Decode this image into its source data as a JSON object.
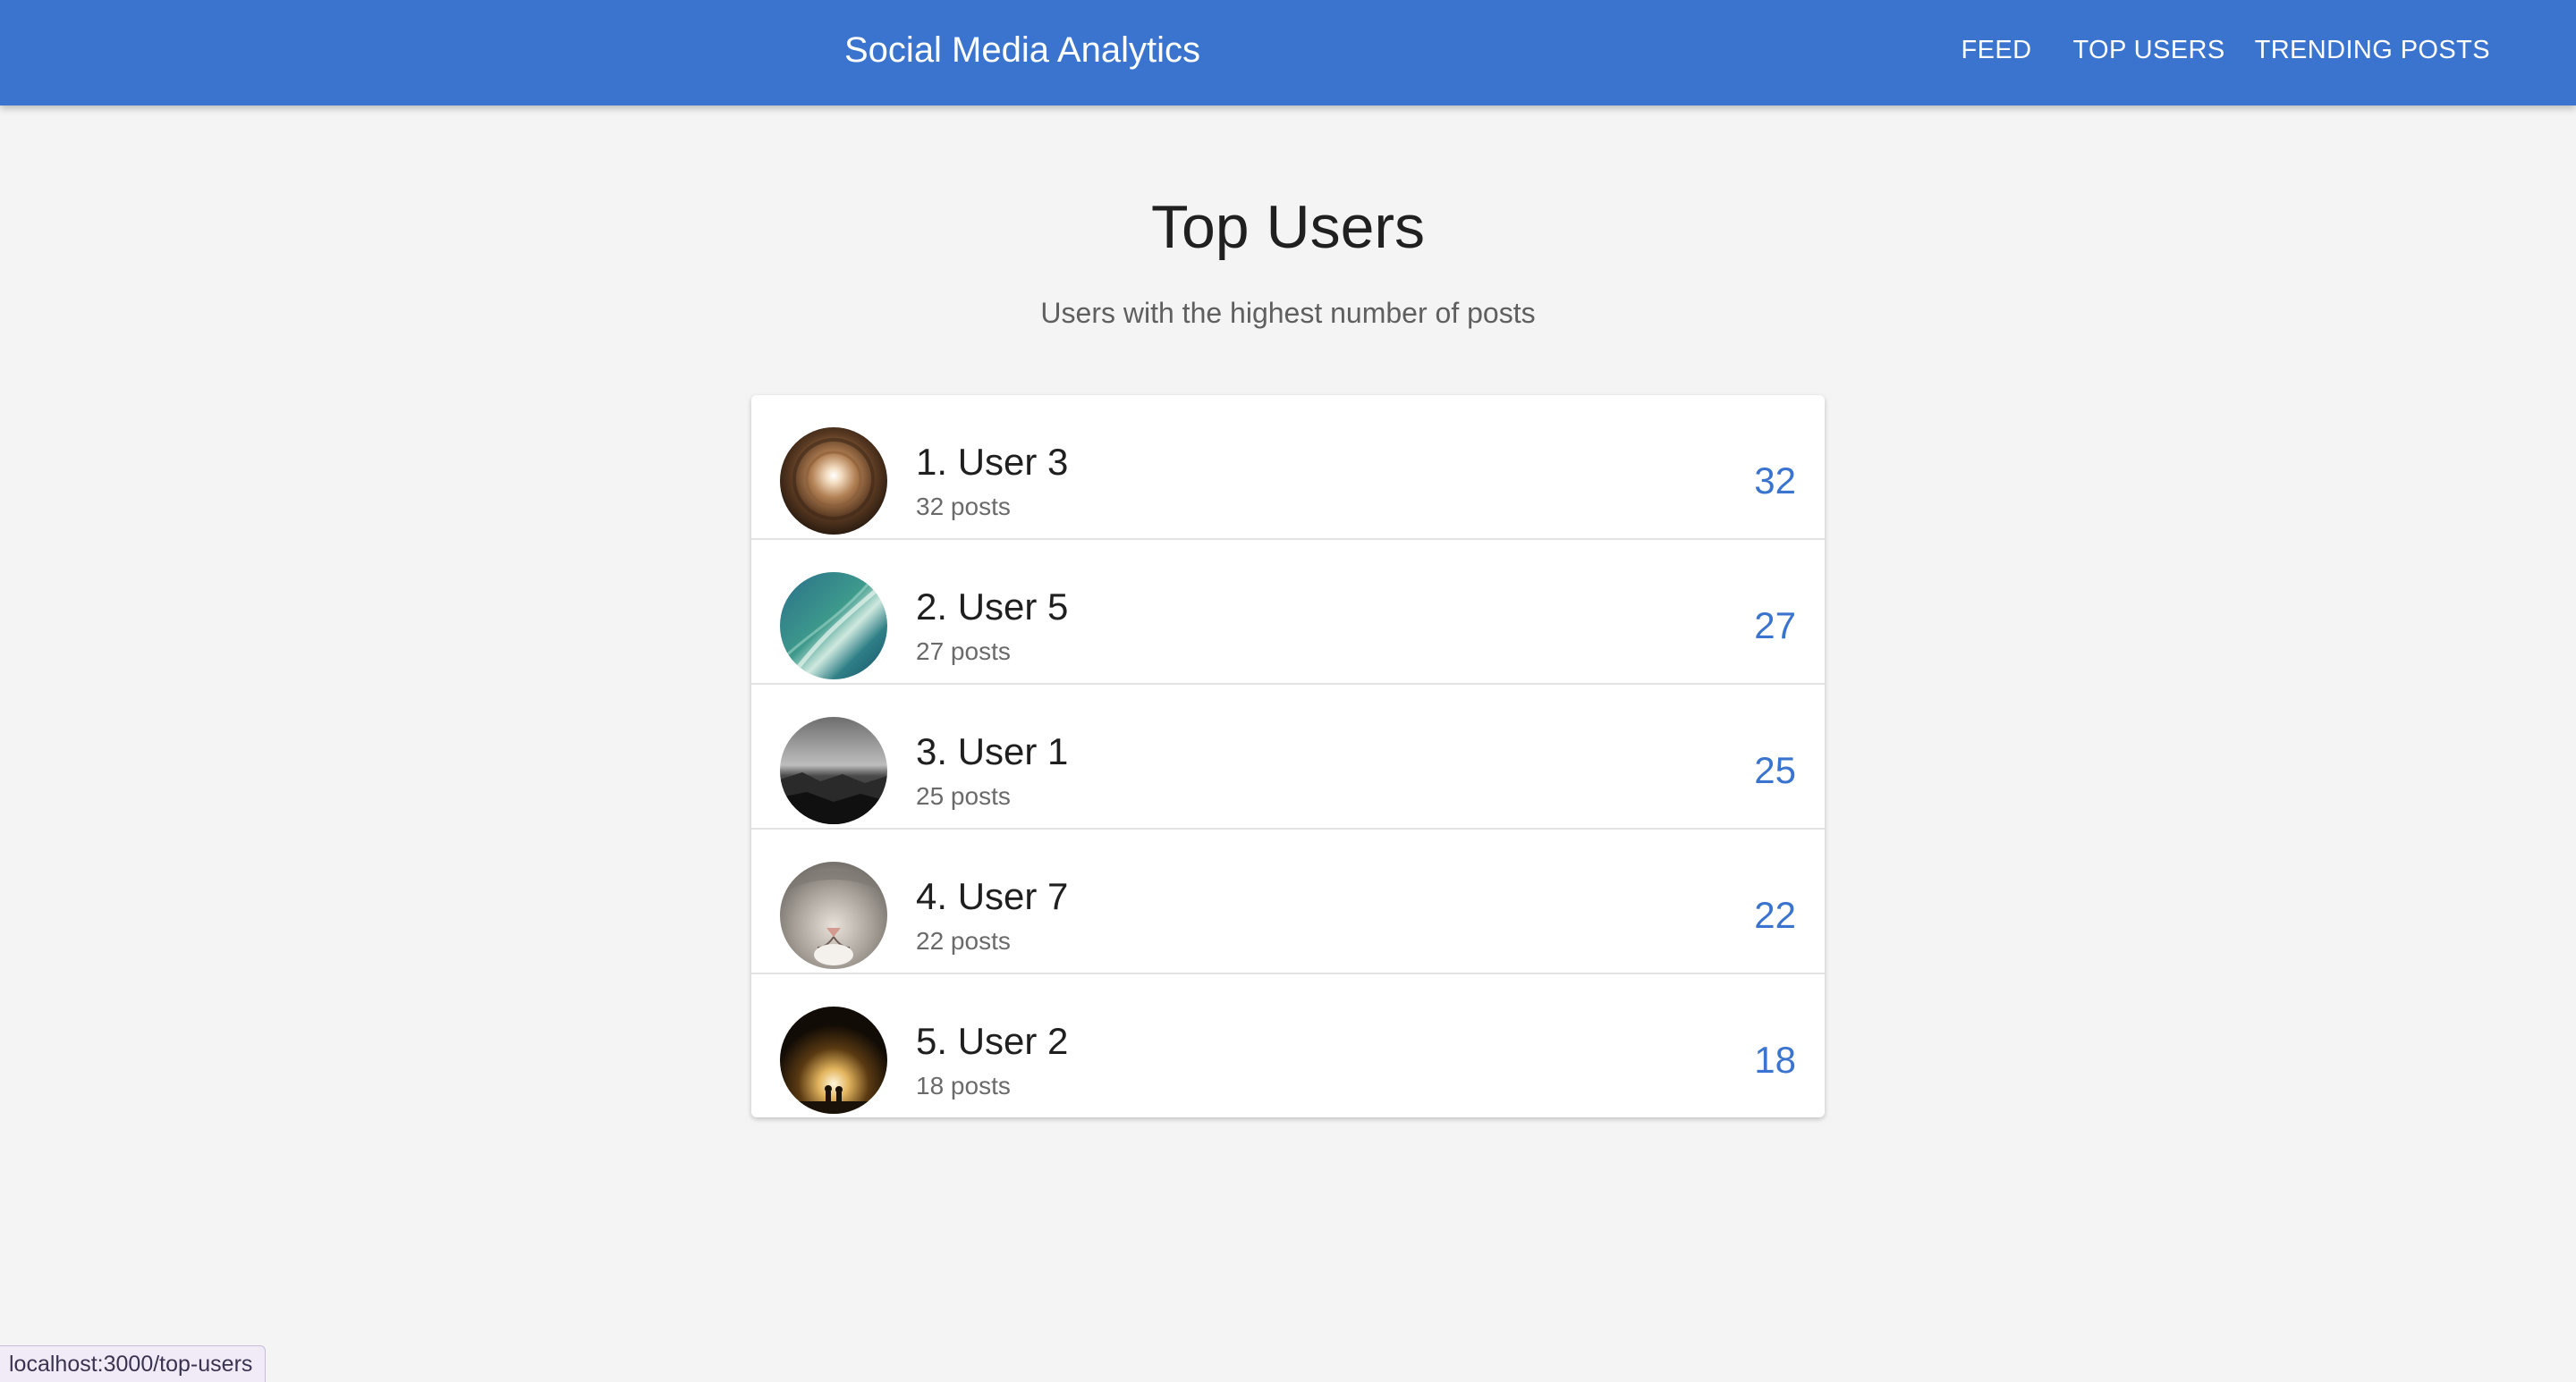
{
  "header": {
    "title": "Social Media Analytics",
    "nav": [
      "FEED",
      "TOP USERS",
      "TRENDING POSTS"
    ],
    "accent_color": "#3a74ce"
  },
  "main": {
    "title": "Top Users",
    "subtitle": "Users with the highest number of posts"
  },
  "users": [
    {
      "name": "1. User 3",
      "posts_label": "32 posts",
      "count": "32",
      "avatar": "light-tunnel-photo"
    },
    {
      "name": "2. User 5",
      "posts_label": "27 posts",
      "count": "27",
      "avatar": "ocean-wave-photo"
    },
    {
      "name": "3. User 1",
      "posts_label": "25 posts",
      "count": "25",
      "avatar": "rocky-coast-photo"
    },
    {
      "name": "4. User 7",
      "posts_label": "22 posts",
      "count": "22",
      "avatar": "cat-face-photo"
    },
    {
      "name": "5. User 2",
      "posts_label": "18 posts",
      "count": "18",
      "avatar": "cave-silhouette-photo"
    }
  ],
  "status_bar": {
    "url": "localhost:3000/top-users"
  }
}
